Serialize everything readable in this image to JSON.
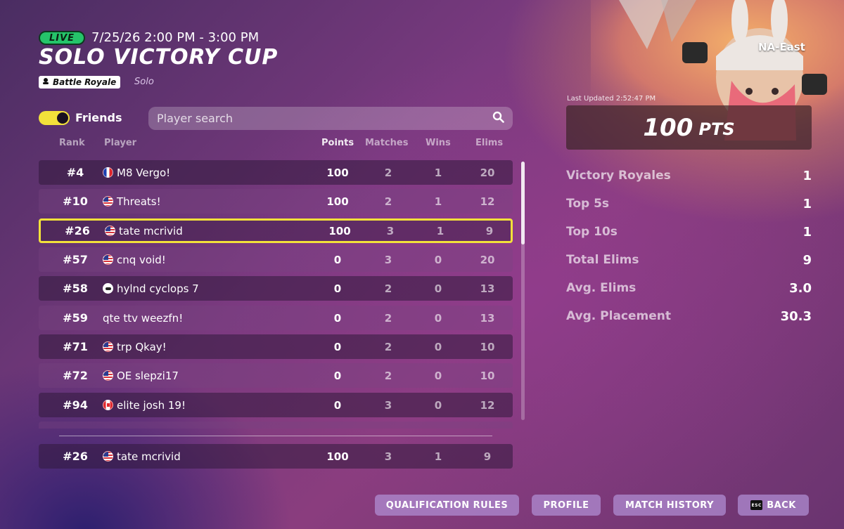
{
  "header": {
    "live_label": "LIVE",
    "time": "7/25/26 2:00 PM - 3:00 PM",
    "title": "SOLO VICTORY CUP",
    "mode": "Battle Royale",
    "mode_sub": "Solo"
  },
  "filters": {
    "friends_label": "Friends",
    "friends_toggle_on": true,
    "search_placeholder": "Player search",
    "search_value": ""
  },
  "table": {
    "columns": [
      "Rank",
      "Player",
      "Points",
      "Matches",
      "Wins",
      "Elims"
    ],
    "rows": [
      {
        "rank": "#4",
        "flag": "flag-fr",
        "player": "M8 Vergo!",
        "points": "100",
        "matches": "2",
        "wins": "1",
        "elims": "20"
      },
      {
        "rank": "#10",
        "flag": "flag-us",
        "player": "Threats!",
        "points": "100",
        "matches": "2",
        "wins": "1",
        "elims": "12"
      },
      {
        "rank": "#26",
        "flag": "flag-us",
        "player": "tate mcrivid",
        "points": "100",
        "matches": "3",
        "wins": "1",
        "elims": "9",
        "highlighted": true
      },
      {
        "rank": "#57",
        "flag": "flag-us",
        "player": "cnq void!",
        "points": "0",
        "matches": "3",
        "wins": "0",
        "elims": "20"
      },
      {
        "rank": "#58",
        "flag": "flag-gp",
        "player": "hylnd cyclops 7",
        "points": "0",
        "matches": "2",
        "wins": "0",
        "elims": "13"
      },
      {
        "rank": "#59",
        "flag": "",
        "player": "qte ttv weezfn!",
        "points": "0",
        "matches": "2",
        "wins": "0",
        "elims": "13"
      },
      {
        "rank": "#71",
        "flag": "flag-us",
        "player": "trp Qkay!",
        "points": "0",
        "matches": "2",
        "wins": "0",
        "elims": "10"
      },
      {
        "rank": "#72",
        "flag": "flag-us",
        "player": "OE slepzi17",
        "points": "0",
        "matches": "2",
        "wins": "0",
        "elims": "10"
      },
      {
        "rank": "#94",
        "flag": "flag-ca",
        "player": "elite josh 19!",
        "points": "0",
        "matches": "3",
        "wins": "0",
        "elims": "12"
      }
    ],
    "self_row": {
      "rank": "#26",
      "flag": "flag-us",
      "player": "tate mcrivid",
      "points": "100",
      "matches": "3",
      "wins": "1",
      "elims": "9"
    }
  },
  "panel": {
    "region": "NA-East",
    "last_updated": "Last Updated 2:52:47 PM",
    "points_value": "100",
    "points_unit": "PTS",
    "stats": [
      {
        "label": "Victory Royales",
        "value": "1"
      },
      {
        "label": "Top 5s",
        "value": "1"
      },
      {
        "label": "Top 10s",
        "value": "1"
      },
      {
        "label": "Total Elims",
        "value": "9"
      },
      {
        "label": "Avg. Elims",
        "value": "3.0"
      },
      {
        "label": "Avg. Placement",
        "value": "30.3"
      }
    ]
  },
  "buttons": {
    "qualification": "QUALIFICATION RULES",
    "profile": "PROFILE",
    "match_history": "MATCH HISTORY",
    "esc_key": "ESC",
    "back": "BACK"
  },
  "colors": {
    "live_green": "#25c46a",
    "highlight_yellow": "#f2e13a",
    "toggle_yellow": "#f2e13a",
    "button_purple": "#af8cd2"
  }
}
